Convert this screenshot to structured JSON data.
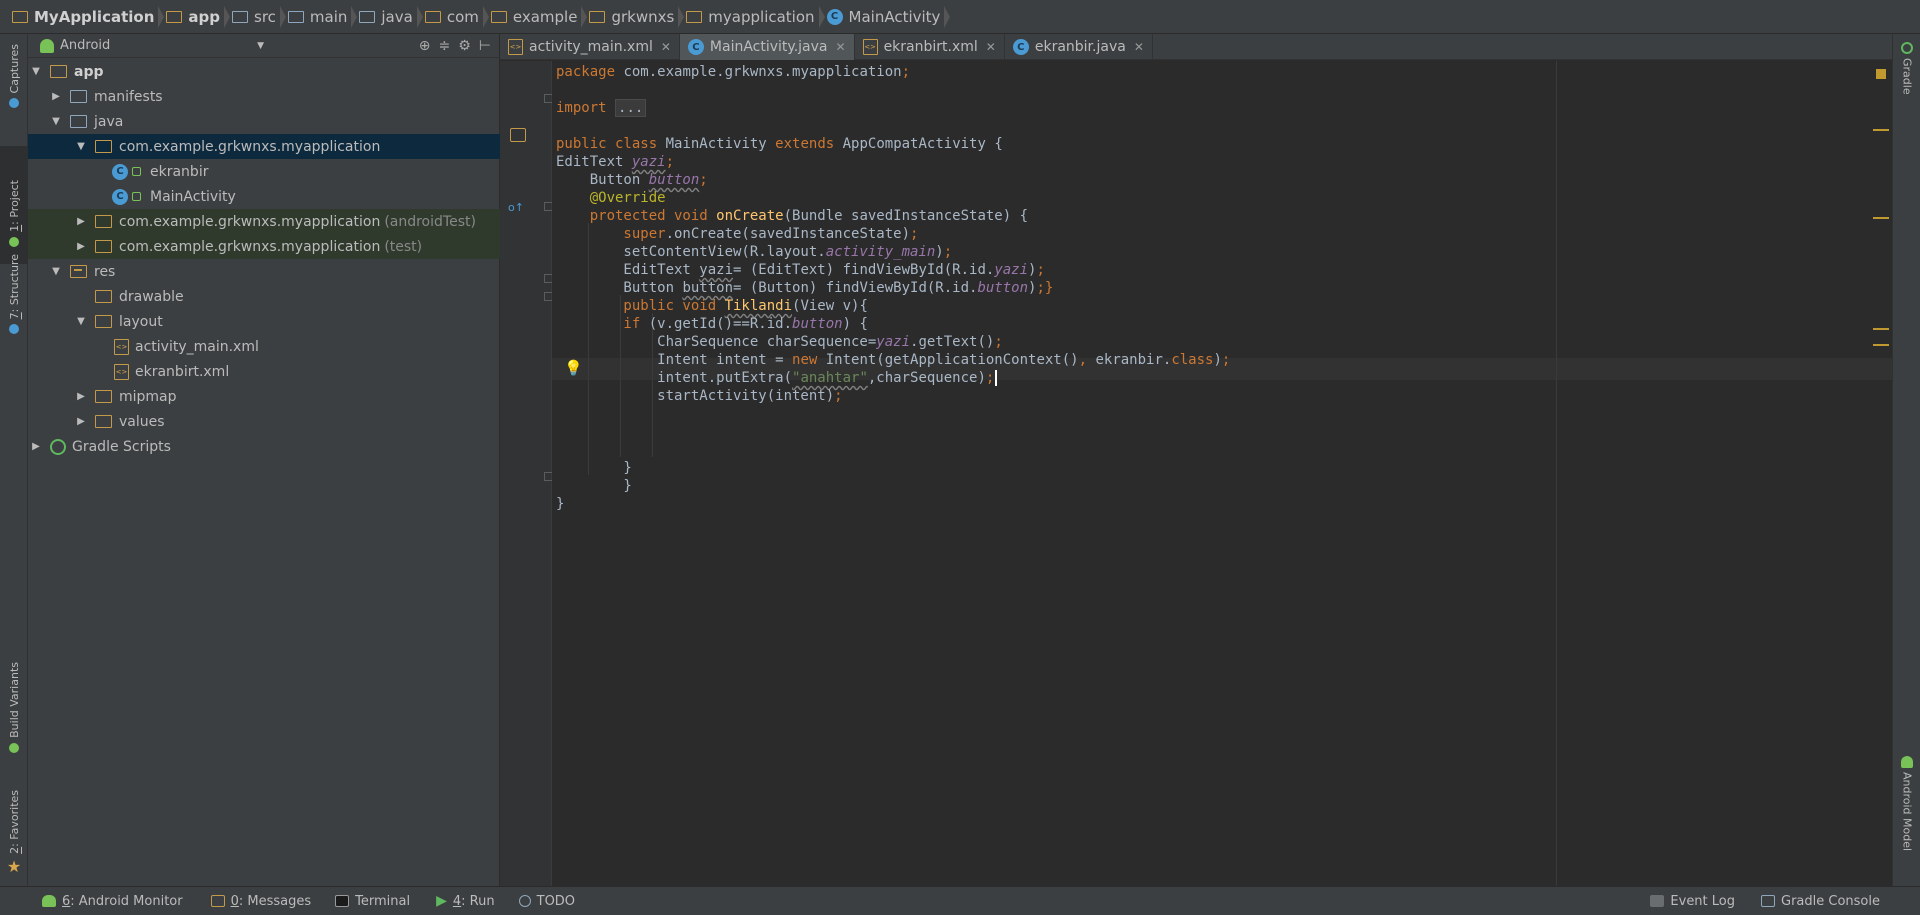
{
  "breadcrumb": [
    "MyApplication",
    "app",
    "src",
    "main",
    "java",
    "com",
    "example",
    "grkwnxs",
    "myapplication",
    "MainActivity"
  ],
  "left_tools": {
    "captures": "Captures",
    "project_num": "1",
    "project": ": Project",
    "structure_num": "7",
    "structure": ": Structure",
    "build_variants": "Build Variants",
    "favorites_num": "2",
    "favorites": ": Favorites"
  },
  "right_tools": {
    "gradle": "Gradle",
    "android_model": "Android Model"
  },
  "project_panel": {
    "view_selector": "Android",
    "tree": {
      "app": "app",
      "manifests": "manifests",
      "java": "java",
      "pkg_main": "com.example.grkwnxs.myapplication",
      "ekranbir": "ekranbir",
      "mainactivity": "MainActivity",
      "pkg_android_test": "com.example.grkwnxs.myapplication",
      "android_test_suffix": "(androidTest)",
      "pkg_test": "com.example.grkwnxs.myapplication",
      "test_suffix": "(test)",
      "res": "res",
      "drawable": "drawable",
      "layout": "layout",
      "activity_main_xml": "activity_main.xml",
      "ekranbirt_xml": "ekranbirt.xml",
      "mipmap": "mipmap",
      "values": "values",
      "gradle_scripts": "Gradle Scripts"
    }
  },
  "editor_tabs": [
    {
      "label": "activity_main.xml",
      "type": "xml"
    },
    {
      "label": "MainActivity.java",
      "type": "class",
      "active": true
    },
    {
      "label": "ekranbirt.xml",
      "type": "xml"
    },
    {
      "label": "ekranbir.java",
      "type": "class"
    }
  ],
  "code": {
    "l1a": "package",
    "l1b": " com.example.grkwnxs.myapplication",
    "l1c": ";",
    "l3a": "import",
    "l3b": "...",
    "l5a": "public class",
    "l5b": " MainActivity ",
    "l5c": "extends",
    "l5d": " AppCompatActivity {",
    "l6a": "EditText ",
    "l6b": "yazi",
    "l6c": ";",
    "l7a": "    Button ",
    "l7b": "button",
    "l7c": ";",
    "l8": "    @Override",
    "l9a": "    protected void ",
    "l9b": "onCreate",
    "l9c": "(Bundle savedInstanceState) {",
    "l10a": "        super",
    "l10b": ".onCreate(savedInstanceState)",
    "l10c": ";",
    "l11a": "        setContentView(R.layout.",
    "l11b": "activity_main",
    "l11c": ")",
    "l11d": ";",
    "l12a": "        EditText ",
    "l12b": "yazi",
    "l12c": "= (EditText) findViewById(R.id.",
    "l12d": "yazi",
    "l12e": ")",
    "l12f": ";",
    "l13a": "        Button ",
    "l13b": "button",
    "l13c": "= (Button) findViewById(R.id.",
    "l13d": "button",
    "l13e": ")",
    "l13f": ";}",
    "l14a": "        public void ",
    "l14b": "Tiklandi",
    "l14c": "(View v){",
    "l15a": "        if ",
    "l15b": "(v.getId()==R.id.",
    "l15c": "button",
    "l15d": ") {",
    "l16a": "            CharSequence charSequence=",
    "l16b": "yazi",
    "l16c": ".getText()",
    "l16d": ";",
    "l17a": "            Intent intent = ",
    "l17b": "new ",
    "l17c": "Intent(getApplicationContext()",
    "l17d": ", ",
    "l17e": "ekranbir.",
    "l17f": "class",
    "l17g": ")",
    "l17h": ";",
    "l18a": "            intent.putExtra(",
    "l18b": "\"anahtar\"",
    "l18c": ",charSequence)",
    "l18d": ";",
    "l19a": "            startActivity(intent)",
    "l19b": ";",
    "l23": "        }",
    "l24": "        }",
    "l25": "}"
  },
  "statusbar": {
    "android_monitor_num": "6",
    "android_monitor": ": Android Monitor",
    "messages_num": "0",
    "messages": ": Messages",
    "terminal": "Terminal",
    "run_num": "4",
    "run": ": Run",
    "todo": "TODO",
    "event_log": "Event Log",
    "gradle_console": "Gradle Console"
  },
  "colors": {
    "keyword": "#cc7832",
    "method": "#ffc66d",
    "annotation": "#bbb529",
    "field": "#9876aa",
    "string": "#6a8759",
    "text": "#a9b7c6",
    "selection": "#0d293e"
  }
}
